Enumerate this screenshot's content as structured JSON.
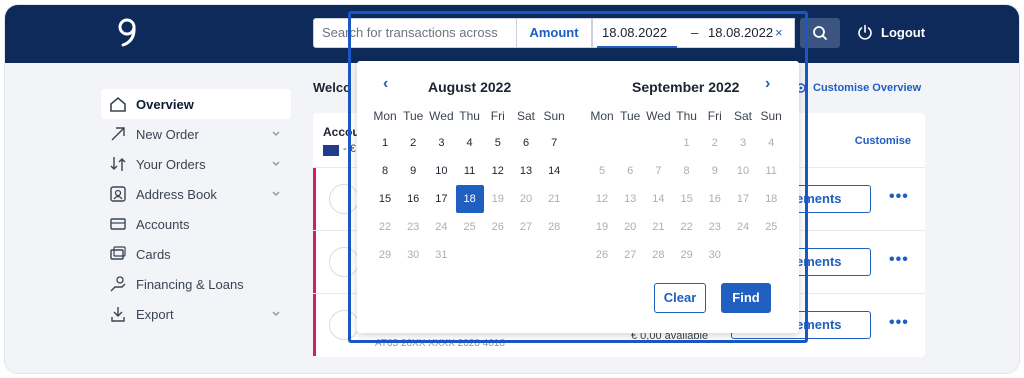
{
  "header": {
    "search_placeholder": "Search for transactions across",
    "amount_label": "Amount",
    "date_from": "18.08.2022",
    "date_separator": "–",
    "date_to": "18.08.2022",
    "date_clear": "×",
    "logout_label": "Logout"
  },
  "sidebar": {
    "items": [
      {
        "label": "Overview",
        "icon": "home-icon",
        "chevron": false
      },
      {
        "label": "New Order",
        "icon": "arrow-up-right-icon",
        "chevron": true
      },
      {
        "label": "Your Orders",
        "icon": "swap-icon",
        "chevron": true
      },
      {
        "label": "Address Book",
        "icon": "contact-icon",
        "chevron": true
      },
      {
        "label": "Accounts",
        "icon": "accounts-icon",
        "chevron": false
      },
      {
        "label": "Cards",
        "icon": "cards-icon",
        "chevron": false
      },
      {
        "label": "Financing & Loans",
        "icon": "loan-icon",
        "chevron": false
      },
      {
        "label": "Export",
        "icon": "download-icon",
        "chevron": true
      }
    ]
  },
  "main": {
    "welcome": "Welco",
    "customise_overview": "Customise Overview",
    "card_title": "Accou",
    "card_currency": "- €",
    "card_customise": "Customise",
    "rows": [
      {
        "button_label": "ements",
        "available": "",
        "iban": ""
      },
      {
        "button_label": "ements",
        "available": "",
        "iban": ""
      },
      {
        "button_label": "ements",
        "available": "€ 0,00 available",
        "iban": "AT65 20XX XXXX 2028 4618"
      }
    ],
    "more": "•••"
  },
  "calendar": {
    "prev": "‹",
    "next": "›",
    "weekdays": [
      "Mon",
      "Tue",
      "Wed",
      "Thu",
      "Fri",
      "Sat",
      "Sun"
    ],
    "months": [
      {
        "title": "August 2022",
        "weeks": [
          [
            {
              "d": "1",
              "m": false
            },
            {
              "d": "2",
              "m": false
            },
            {
              "d": "3",
              "m": false
            },
            {
              "d": "4",
              "m": false
            },
            {
              "d": "5",
              "m": false
            },
            {
              "d": "6",
              "m": false
            },
            {
              "d": "7",
              "m": false
            }
          ],
          [
            {
              "d": "8",
              "m": false
            },
            {
              "d": "9",
              "m": false
            },
            {
              "d": "10",
              "m": false
            },
            {
              "d": "11",
              "m": false
            },
            {
              "d": "12",
              "m": false
            },
            {
              "d": "13",
              "m": false
            },
            {
              "d": "14",
              "m": false
            }
          ],
          [
            {
              "d": "15",
              "m": false
            },
            {
              "d": "16",
              "m": false
            },
            {
              "d": "17",
              "m": false
            },
            {
              "d": "18",
              "m": false,
              "sel": true
            },
            {
              "d": "19",
              "m": true
            },
            {
              "d": "20",
              "m": true
            },
            {
              "d": "21",
              "m": true
            }
          ],
          [
            {
              "d": "22",
              "m": true
            },
            {
              "d": "23",
              "m": true
            },
            {
              "d": "24",
              "m": true
            },
            {
              "d": "25",
              "m": true
            },
            {
              "d": "26",
              "m": true
            },
            {
              "d": "27",
              "m": true
            },
            {
              "d": "28",
              "m": true
            }
          ],
          [
            {
              "d": "29",
              "m": true
            },
            {
              "d": "30",
              "m": true
            },
            {
              "d": "31",
              "m": true
            }
          ]
        ]
      },
      {
        "title": "September 2022",
        "weeks": [
          [
            null,
            null,
            null,
            {
              "d": "1",
              "m": true
            },
            {
              "d": "2",
              "m": true
            },
            {
              "d": "3",
              "m": true
            },
            {
              "d": "4",
              "m": true
            }
          ],
          [
            {
              "d": "5",
              "m": true
            },
            {
              "d": "6",
              "m": true
            },
            {
              "d": "7",
              "m": true
            },
            {
              "d": "8",
              "m": true
            },
            {
              "d": "9",
              "m": true
            },
            {
              "d": "10",
              "m": true
            },
            {
              "d": "11",
              "m": true
            }
          ],
          [
            {
              "d": "12",
              "m": true
            },
            {
              "d": "13",
              "m": true
            },
            {
              "d": "14",
              "m": true
            },
            {
              "d": "15",
              "m": true
            },
            {
              "d": "16",
              "m": true
            },
            {
              "d": "17",
              "m": true
            },
            {
              "d": "18",
              "m": true
            }
          ],
          [
            {
              "d": "19",
              "m": true
            },
            {
              "d": "20",
              "m": true
            },
            {
              "d": "21",
              "m": true
            },
            {
              "d": "22",
              "m": true
            },
            {
              "d": "23",
              "m": true
            },
            {
              "d": "24",
              "m": true
            },
            {
              "d": "25",
              "m": true
            }
          ],
          [
            {
              "d": "26",
              "m": true
            },
            {
              "d": "27",
              "m": true
            },
            {
              "d": "28",
              "m": true
            },
            {
              "d": "29",
              "m": true
            },
            {
              "d": "30",
              "m": true
            }
          ]
        ]
      }
    ],
    "clear_label": "Clear",
    "find_label": "Find"
  },
  "colors": {
    "navy": "#0d2a5a",
    "accent": "#1f5fbf",
    "status_bar": "#d41d5a"
  }
}
